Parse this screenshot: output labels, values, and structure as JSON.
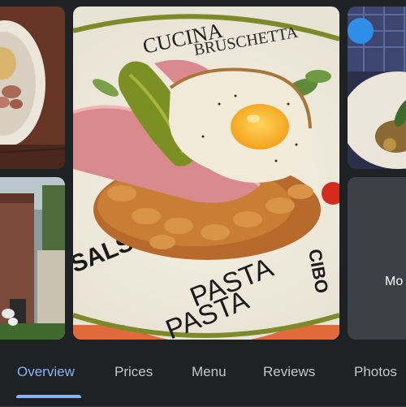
{
  "gallery": {
    "main_photo": {
      "plate_text": [
        "CUCINA",
        "BRUSCHETTA",
        "SALSA",
        "PASTA",
        "PASTA",
        "CIBO"
      ]
    },
    "more_label": "Mo"
  },
  "tabs": [
    {
      "label": "Overview",
      "active": true
    },
    {
      "label": "Prices",
      "active": false
    },
    {
      "label": "Menu",
      "active": false
    },
    {
      "label": "Reviews",
      "active": false
    },
    {
      "label": "Photos",
      "active": false
    }
  ],
  "colors": {
    "accent": "#8ab4f8",
    "background": "#1f2225",
    "tab_text": "#c4c7c5"
  }
}
